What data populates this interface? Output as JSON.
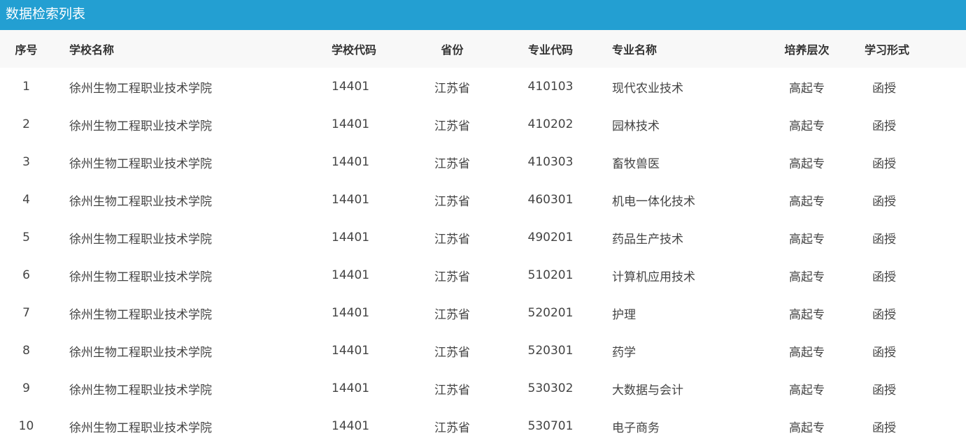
{
  "page": {
    "title": "数据检索列表"
  },
  "columns": [
    "序号",
    "学校名称",
    "学校代码",
    "省份",
    "专业代码",
    "专业名称",
    "培养层次",
    "学习形式"
  ],
  "rows": [
    [
      "1",
      "徐州生物工程职业技术学院",
      "14401",
      "江苏省",
      "410103",
      "现代农业技术",
      "高起专",
      "函授"
    ],
    [
      "2",
      "徐州生物工程职业技术学院",
      "14401",
      "江苏省",
      "410202",
      "园林技术",
      "高起专",
      "函授"
    ],
    [
      "3",
      "徐州生物工程职业技术学院",
      "14401",
      "江苏省",
      "410303",
      "畜牧兽医",
      "高起专",
      "函授"
    ],
    [
      "4",
      "徐州生物工程职业技术学院",
      "14401",
      "江苏省",
      "460301",
      "机电一体化技术",
      "高起专",
      "函授"
    ],
    [
      "5",
      "徐州生物工程职业技术学院",
      "14401",
      "江苏省",
      "490201",
      "药品生产技术",
      "高起专",
      "函授"
    ],
    [
      "6",
      "徐州生物工程职业技术学院",
      "14401",
      "江苏省",
      "510201",
      "计算机应用技术",
      "高起专",
      "函授"
    ],
    [
      "7",
      "徐州生物工程职业技术学院",
      "14401",
      "江苏省",
      "520201",
      "护理",
      "高起专",
      "函授"
    ],
    [
      "8",
      "徐州生物工程职业技术学院",
      "14401",
      "江苏省",
      "520301",
      "药学",
      "高起专",
      "函授"
    ],
    [
      "9",
      "徐州生物工程职业技术学院",
      "14401",
      "江苏省",
      "530302",
      "大数据与会计",
      "高起专",
      "函授"
    ],
    [
      "10",
      "徐州生物工程职业技术学院",
      "14401",
      "江苏省",
      "530701",
      "电子商务",
      "高起专",
      "函授"
    ]
  ],
  "colors": {
    "header_bar": "#239fd2",
    "table_header_bg": "#f8f8f8"
  }
}
